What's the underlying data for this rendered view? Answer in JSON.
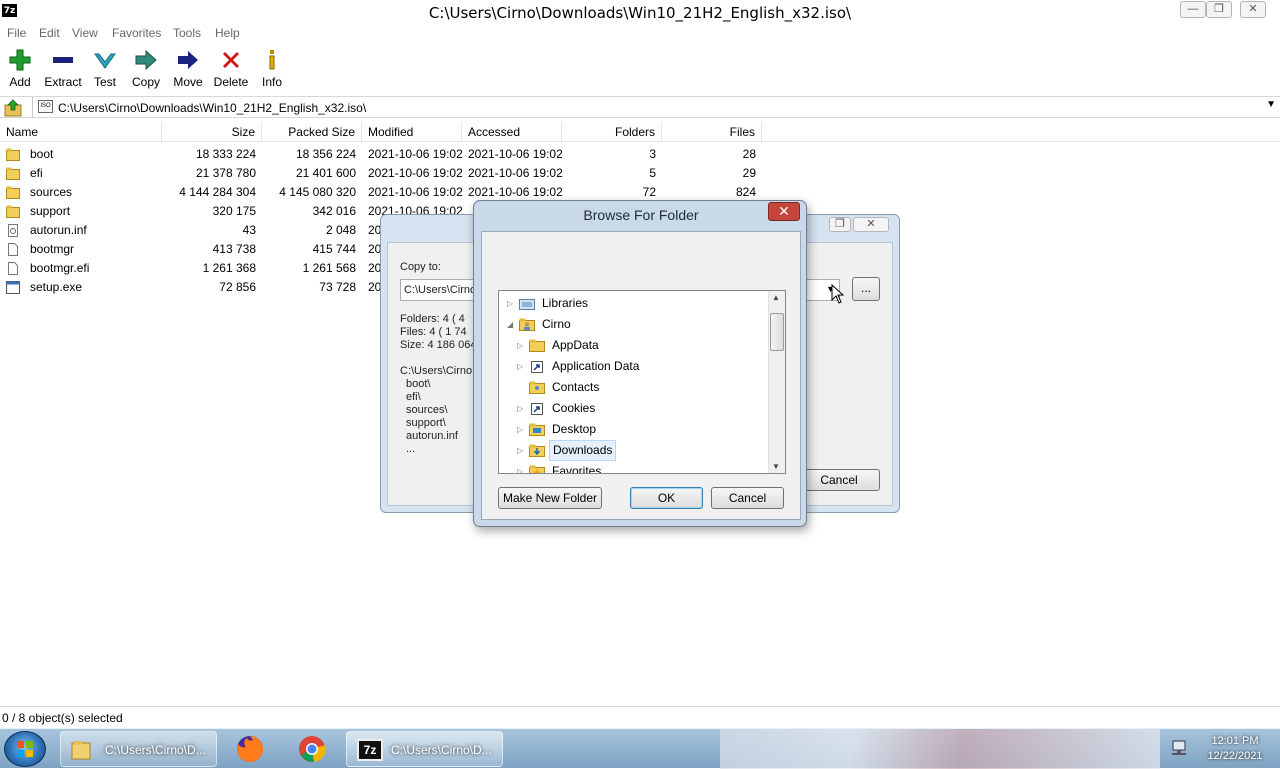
{
  "window": {
    "title": "C:\\Users\\Cirno\\Downloads\\Win10_21H2_English_x32.iso\\",
    "app_icon": "7z",
    "controls": [
      "minimize-icon",
      "restore-icon",
      "close-icon"
    ]
  },
  "menu": [
    "File",
    "Edit",
    "View",
    "Favorites",
    "Tools",
    "Help"
  ],
  "toolbar": {
    "add": "Add",
    "extract": "Extract",
    "test": "Test",
    "copy": "Copy",
    "move": "Move",
    "delete": "Delete",
    "info": "Info",
    "colors": {
      "add": "#1e9e2b",
      "extract": "#1a237e",
      "test": "#26a7c0",
      "copy": "#2e8b7a",
      "move": "#1a237e",
      "delete": "#d01818"
    }
  },
  "address": {
    "icon_text": "ISO",
    "path": "C:\\Users\\Cirno\\Downloads\\Win10_21H2_English_x32.iso\\"
  },
  "columns": {
    "name": "Name",
    "size": "Size",
    "packed": "Packed Size",
    "modified": "Modified",
    "accessed": "Accessed",
    "folders": "Folders",
    "files": "Files"
  },
  "files": [
    {
      "name": "boot",
      "type": "folder",
      "size": "18 333 224",
      "packed": "18 356 224",
      "modified": "2021-10-06 19:02",
      "accessed": "2021-10-06 19:02",
      "folders": "3",
      "files": "28"
    },
    {
      "name": "efi",
      "type": "folder",
      "size": "21 378 780",
      "packed": "21 401 600",
      "modified": "2021-10-06 19:02",
      "accessed": "2021-10-06 19:02",
      "folders": "5",
      "files": "29"
    },
    {
      "name": "sources",
      "type": "folder",
      "size": "4 144 284 304",
      "packed": "4 145 080 320",
      "modified": "2021-10-06 19:02",
      "accessed": "2021-10-06 19:02",
      "folders": "72",
      "files": "824"
    },
    {
      "name": "support",
      "type": "folder",
      "size": "320 175",
      "packed": "342 016",
      "modified": "2021-10-06 19:02",
      "accessed": "",
      "folders": "",
      "files": ""
    },
    {
      "name": "autorun.inf",
      "type": "config",
      "size": "43",
      "packed": "2 048",
      "modified": "20",
      "accessed": "",
      "folders": "",
      "files": ""
    },
    {
      "name": "bootmgr",
      "type": "file",
      "size": "413 738",
      "packed": "415 744",
      "modified": "20",
      "accessed": "",
      "folders": "",
      "files": ""
    },
    {
      "name": "bootmgr.efi",
      "type": "file",
      "size": "1 261 368",
      "packed": "1 261 568",
      "modified": "20",
      "accessed": "",
      "folders": "",
      "files": ""
    },
    {
      "name": "setup.exe",
      "type": "exe",
      "size": "72 856",
      "packed": "73 728",
      "modified": "20",
      "accessed": "",
      "folders": "",
      "files": ""
    }
  ],
  "status": "0 / 8 object(s) selected",
  "extract_dialog": {
    "copy_to_label": "Copy to:",
    "copy_to_value": "C:\\Users\\Cirno",
    "browse_label": "...",
    "folders_line": "Folders: 4    ( 4",
    "files_line": "Files: 4    ( 1 74",
    "size_line": "Size: 4 186 064",
    "path_line": "C:\\Users\\Cirno",
    "items": [
      "boot\\",
      "efi\\",
      "sources\\",
      "support\\",
      "autorun.inf",
      "..."
    ],
    "cancel": "Cancel"
  },
  "browse_dialog": {
    "title": "Browse For Folder",
    "close": "✕",
    "tree": [
      {
        "label": "Libraries",
        "depth": 0,
        "arrow": "▷",
        "icon": "library-icon"
      },
      {
        "label": "Cirno",
        "depth": 0,
        "arrow": "◢",
        "icon": "user-folder-icon"
      },
      {
        "label": "AppData",
        "depth": 1,
        "arrow": "▷",
        "icon": "folder-icon"
      },
      {
        "label": "Application Data",
        "depth": 1,
        "arrow": "▷",
        "icon": "shortcut-folder-icon"
      },
      {
        "label": "Contacts",
        "depth": 1,
        "arrow": "",
        "icon": "contacts-folder-icon"
      },
      {
        "label": "Cookies",
        "depth": 1,
        "arrow": "▷",
        "icon": "shortcut-folder-icon"
      },
      {
        "label": "Desktop",
        "depth": 1,
        "arrow": "▷",
        "icon": "desktop-folder-icon"
      },
      {
        "label": "Downloads",
        "depth": 1,
        "arrow": "▷",
        "icon": "downloads-folder-icon",
        "selected": true
      },
      {
        "label": "Favorites",
        "depth": 1,
        "arrow": "▷",
        "icon": "favorites-folder-icon"
      }
    ],
    "make_new_folder": "Make New Folder",
    "ok": "OK",
    "cancel": "Cancel"
  },
  "taskbar": {
    "items": [
      {
        "label": "C:\\Users\\Cirno\\D...",
        "icon": "explorer-folder-icon"
      },
      {
        "label": "",
        "icon": "firefox-icon"
      },
      {
        "label": "",
        "icon": "chrome-icon"
      },
      {
        "label": "C:\\Users\\Cirno\\D...",
        "icon": "7zip-icon",
        "active": true
      }
    ],
    "time": "12:01 PM",
    "date": "12/22/2021"
  }
}
